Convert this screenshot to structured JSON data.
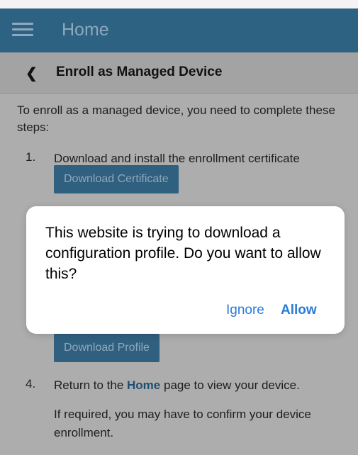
{
  "appbar": {
    "title": "Home",
    "menu_icon": "hamburger-menu-icon"
  },
  "subheader": {
    "back_icon": "chevron-left-icon",
    "title": "Enroll as Managed Device"
  },
  "content": {
    "intro": "To enroll as a managed device, you need to complete these steps:",
    "steps": [
      {
        "number": "1.",
        "text": "Download and install the enrollment certificate",
        "button": "Download Certificate"
      },
      {
        "button": "Download Profile"
      },
      {
        "number": "4.",
        "text_before": "Return to the",
        "link": "Home",
        "text_after": "page to view your device."
      }
    ],
    "note": "If required, you may have to confirm your device enrollment."
  },
  "dialog": {
    "message": "This website is trying to download a configuration profile. Do you want to allow this?",
    "ignore": "Ignore",
    "allow": "Allow"
  },
  "colors": {
    "appbar": "#2e6283",
    "button": "#30607f",
    "dialog_action": "#2a7bd8",
    "overlay": "#adadad"
  }
}
